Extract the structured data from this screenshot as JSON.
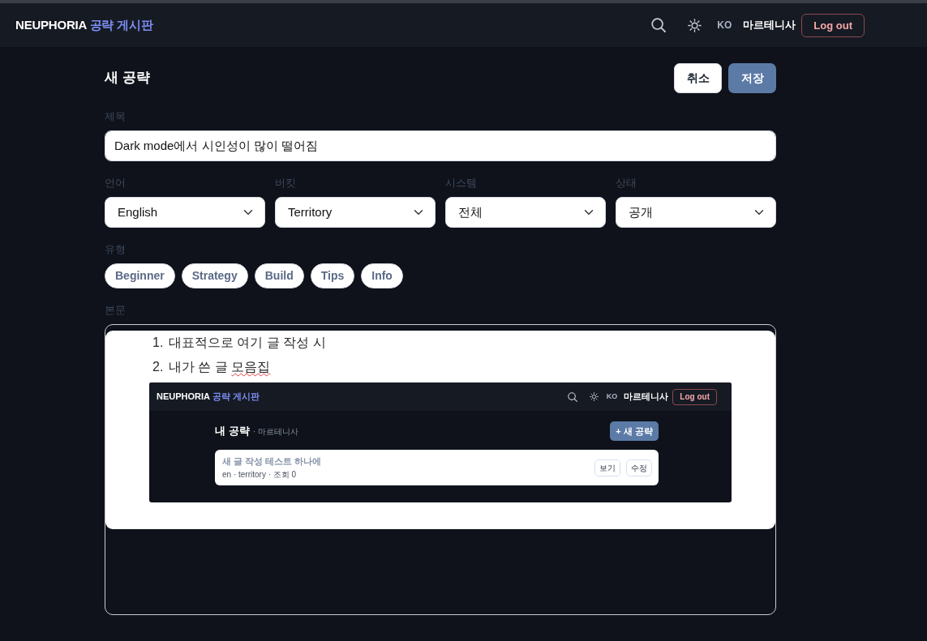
{
  "navbar": {
    "brand": "NEUPHORIA",
    "brand_suffix": "공략 게시판",
    "language": "KO",
    "username": "마르테니사",
    "logout": "Log out"
  },
  "page": {
    "title": "새 공략",
    "buttons": [
      {
        "label": "취소",
        "kind": "secondary"
      },
      {
        "label": "저장",
        "kind": "primary"
      }
    ]
  },
  "form": {
    "title_field": {
      "label": "제목",
      "value": "Dark mode에서 시인성이 많이 떨어짐"
    },
    "selects": [
      {
        "label": "언어",
        "value": "English"
      },
      {
        "label": "버킷",
        "value": "Territory"
      },
      {
        "label": "시스템",
        "value": "전체"
      },
      {
        "label": "상태",
        "value": "공개"
      }
    ],
    "type": {
      "label": "유형",
      "chips": [
        {
          "label": "Beginner",
          "selected": false
        },
        {
          "label": "Strategy",
          "selected": false
        },
        {
          "label": "Build",
          "selected": false
        },
        {
          "label": "Tips",
          "selected": false
        },
        {
          "label": "Info",
          "selected": false
        }
      ]
    },
    "body": {
      "label": "본문",
      "list": [
        {
          "marker": "1.",
          "segments": [
            {
              "text": "대표적으로 여기 글 작성 시",
              "misspelled": false
            }
          ]
        },
        {
          "marker": "2.",
          "segments": [
            {
              "text": "내가 쓴 글 ",
              "misspelled": false
            },
            {
              "text": "모음집",
              "misspelled": true
            }
          ]
        }
      ],
      "embedded_screenshot": {
        "navbar": {
          "brand": "NEUPHORIA",
          "brand_suffix": "공략 게시판",
          "language": "KO",
          "username": "마르테니사",
          "logout": "Log out"
        },
        "heading": "내 공략",
        "subheading": "· 마르테니사",
        "new_button": "+ 새 공략",
        "posts": [
          {
            "title": "새 글 작성 테스트 하나에",
            "meta": "en · territory · 조회 0",
            "buttons": [
              "보기",
              "수정"
            ]
          }
        ]
      }
    }
  }
}
